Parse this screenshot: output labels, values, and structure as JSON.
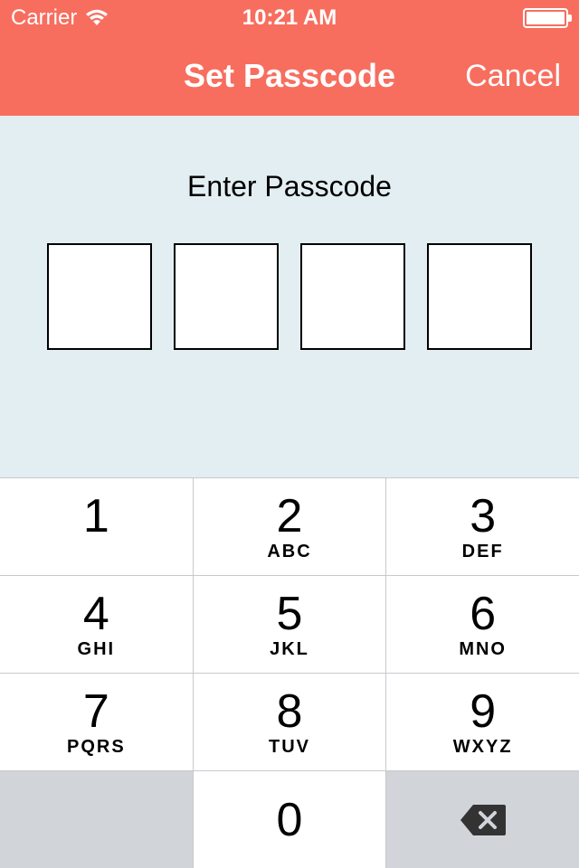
{
  "status": {
    "carrier": "Carrier",
    "time": "10:21 AM"
  },
  "nav": {
    "title": "Set Passcode",
    "cancel": "Cancel"
  },
  "content": {
    "prompt": "Enter Passcode"
  },
  "keypad": {
    "keys": [
      {
        "digit": "1",
        "letters": ""
      },
      {
        "digit": "2",
        "letters": "ABC"
      },
      {
        "digit": "3",
        "letters": "DEF"
      },
      {
        "digit": "4",
        "letters": "GHI"
      },
      {
        "digit": "5",
        "letters": "JKL"
      },
      {
        "digit": "6",
        "letters": "MNO"
      },
      {
        "digit": "7",
        "letters": "PQRS"
      },
      {
        "digit": "8",
        "letters": "TUV"
      },
      {
        "digit": "9",
        "letters": "WXYZ"
      }
    ],
    "zero": "0"
  }
}
